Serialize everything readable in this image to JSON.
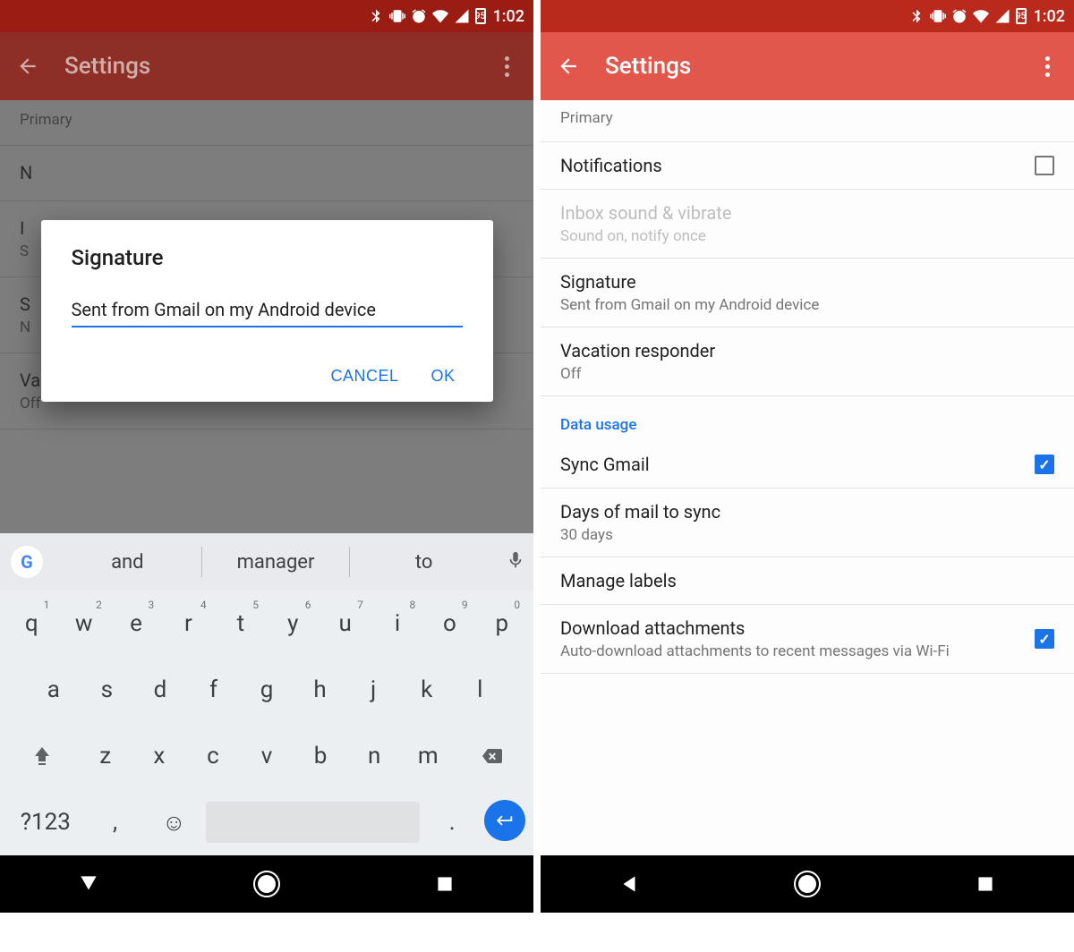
{
  "status": {
    "time": "1:02",
    "battery": "95"
  },
  "appbar": {
    "title": "Settings"
  },
  "dialog": {
    "title": "Signature",
    "value": "Sent from Gmail on my Android device",
    "cancel": "CANCEL",
    "ok": "OK"
  },
  "left_list": {
    "primary": "Primary",
    "notifications_initial": "N",
    "inbox_initial_1": "I",
    "inbox_initial_2": "S",
    "sig_initial_1": "S",
    "sig_initial_2": "N",
    "vacation_title": "Vacation responder",
    "vacation_sub": "Off"
  },
  "keyboard": {
    "suggestions": [
      "and",
      "manager",
      "to"
    ],
    "row1": [
      {
        "k": "q",
        "n": "1"
      },
      {
        "k": "w",
        "n": "2"
      },
      {
        "k": "e",
        "n": "3"
      },
      {
        "k": "r",
        "n": "4"
      },
      {
        "k": "t",
        "n": "5"
      },
      {
        "k": "y",
        "n": "6"
      },
      {
        "k": "u",
        "n": "7"
      },
      {
        "k": "i",
        "n": "8"
      },
      {
        "k": "o",
        "n": "9"
      },
      {
        "k": "p",
        "n": "0"
      }
    ],
    "row2": [
      "a",
      "s",
      "d",
      "f",
      "g",
      "h",
      "j",
      "k",
      "l"
    ],
    "row3": [
      "z",
      "x",
      "c",
      "v",
      "b",
      "n",
      "m"
    ],
    "sym": "?123",
    "comma": ",",
    "period": "."
  },
  "right_list": {
    "primary": "Primary",
    "notifications": "Notifications",
    "inbox_title": "Inbox sound & vibrate",
    "inbox_sub": "Sound on, notify once",
    "sig_title": "Signature",
    "sig_sub": "Sent from Gmail on my Android device",
    "vacation_title": "Vacation responder",
    "vacation_sub": "Off",
    "section": "Data usage",
    "sync": "Sync Gmail",
    "days_title": "Days of mail to sync",
    "days_sub": "30 days",
    "labels": "Manage labels",
    "dl_title": "Download attachments",
    "dl_sub": "Auto-download attachments to recent messages via Wi-Fi"
  }
}
